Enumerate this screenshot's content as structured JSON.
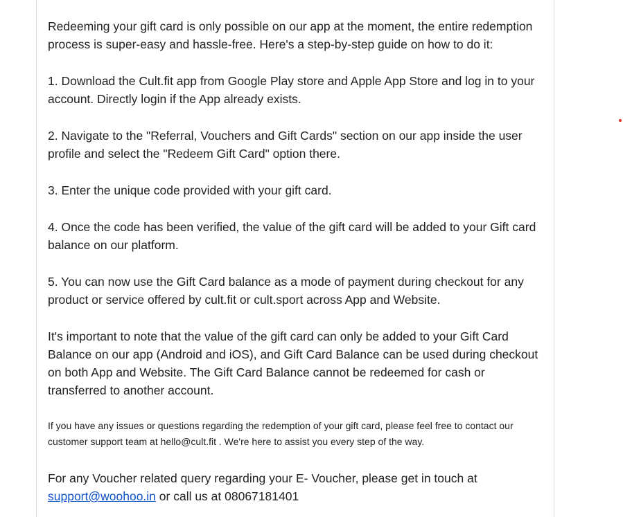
{
  "email": {
    "intro": "Redeeming your gift card is only possible on our app at the moment, the entire redemption process is super-easy and hassle-free. Here's a step-by-step guide on how to do it:",
    "steps": [
      "1. Download the Cult.fit app from Google Play store and Apple App Store and log in to your account. Directly login if the App already exists.",
      "2. Navigate to the \"Referral, Vouchers and Gift Cards\" section on our app inside the user profile and select the \"Redeem Gift Card\" option there.",
      "3. Enter the unique code provided with your gift card.",
      "4. Once the code has been verified, the value of the gift card will be added to your Gift card balance on our platform.",
      "5. You can now use the Gift Card balance as a mode of payment during checkout for any product or service offered by cult.fit or cult.sport across App and Website."
    ],
    "note": "It's important to note that the value of the gift card can only be added to your Gift Card Balance on our app (Android and iOS), and Gift Card Balance can be used during checkout on both App and Website. The Gift Card Balance cannot be redeemed for cash or transferred to another account.",
    "support_note": "If you have any issues or questions regarding the redemption of your gift card, please feel free to contact our customer support team at hello@cult.fit . We're here to assist you every step of the way.",
    "voucher_query": {
      "prefix": "For any Voucher related query regarding your E- Voucher, please get in touch at",
      "link_text": "support@woohoo.in",
      "suffix": " or call us at 08067181401"
    }
  },
  "colors": {
    "text": "#222222",
    "link": "#1155cc",
    "border": "#dadce0",
    "indicator_dot": "#d93025"
  }
}
